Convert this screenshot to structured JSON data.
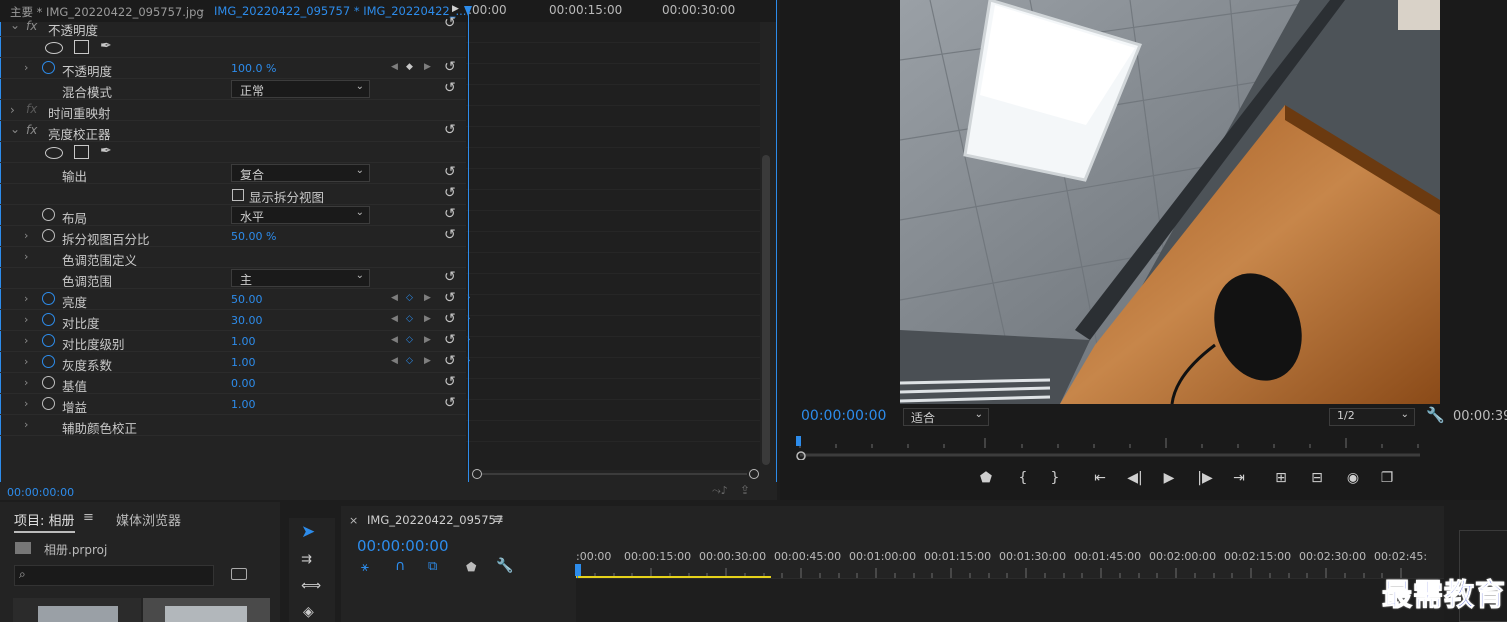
{
  "effect_controls": {
    "tab_master": "主要 * IMG_20220422_095757.jpg",
    "tab_clip": "IMG_20220422_095757 * IMG_20220422_...",
    "ruler": [
      ":00:00",
      "00:00:15:00",
      "00:00:30:00"
    ],
    "timecode": "00:00:00:00",
    "rows": {
      "opacity_section": "不透明度",
      "opacity": {
        "label": "不透明度",
        "value": "100.0 %"
      },
      "blend_mode": {
        "label": "混合模式",
        "value": "正常"
      },
      "time_remap": "时间重映射",
      "brightness_corrector": "亮度校正器",
      "output": {
        "label": "输出",
        "value": "复合"
      },
      "split_view": "显示拆分视图",
      "layout": {
        "label": "布局",
        "value": "水平"
      },
      "split_percent": {
        "label": "拆分视图百分比",
        "value": "50.00 %"
      },
      "tonal_def": "色调范围定义",
      "tonal_range": {
        "label": "色调范围",
        "value": "主"
      },
      "brightness": {
        "label": "亮度",
        "value": "50.00"
      },
      "contrast": {
        "label": "对比度",
        "value": "30.00"
      },
      "contrast_level": {
        "label": "对比度级别",
        "value": "1.00"
      },
      "gamma": {
        "label": "灰度系数",
        "value": "1.00"
      },
      "pedestal": {
        "label": "基值",
        "value": "0.00"
      },
      "gain": {
        "label": "增益",
        "value": "1.00"
      },
      "secondary": "辅助颜色校正"
    }
  },
  "program": {
    "timecode": "00:00:00:00",
    "fit": "适合",
    "resolution": "1/2",
    "timecode_right": "00:00:39"
  },
  "project": {
    "tab_project": "项目: 相册",
    "tab_media": "媒体浏览器",
    "file": "相册.prproj"
  },
  "sequence": {
    "name": "IMG_20220422_095757",
    "timecode": "00:00:00:00",
    "ruler": [
      ":00:00",
      "00:00:15:00",
      "00:00:30:00",
      "00:00:45:00",
      "00:01:00:00",
      "00:01:15:00",
      "00:01:30:00",
      "00:01:45:00",
      "00:02:00:00",
      "00:02:15:00",
      "00:02:30:00",
      "00:02:45:"
    ]
  },
  "watermark": "最需教育",
  "colors": {
    "accent": "#2d8ceb",
    "work_area": "#e6d21a"
  }
}
